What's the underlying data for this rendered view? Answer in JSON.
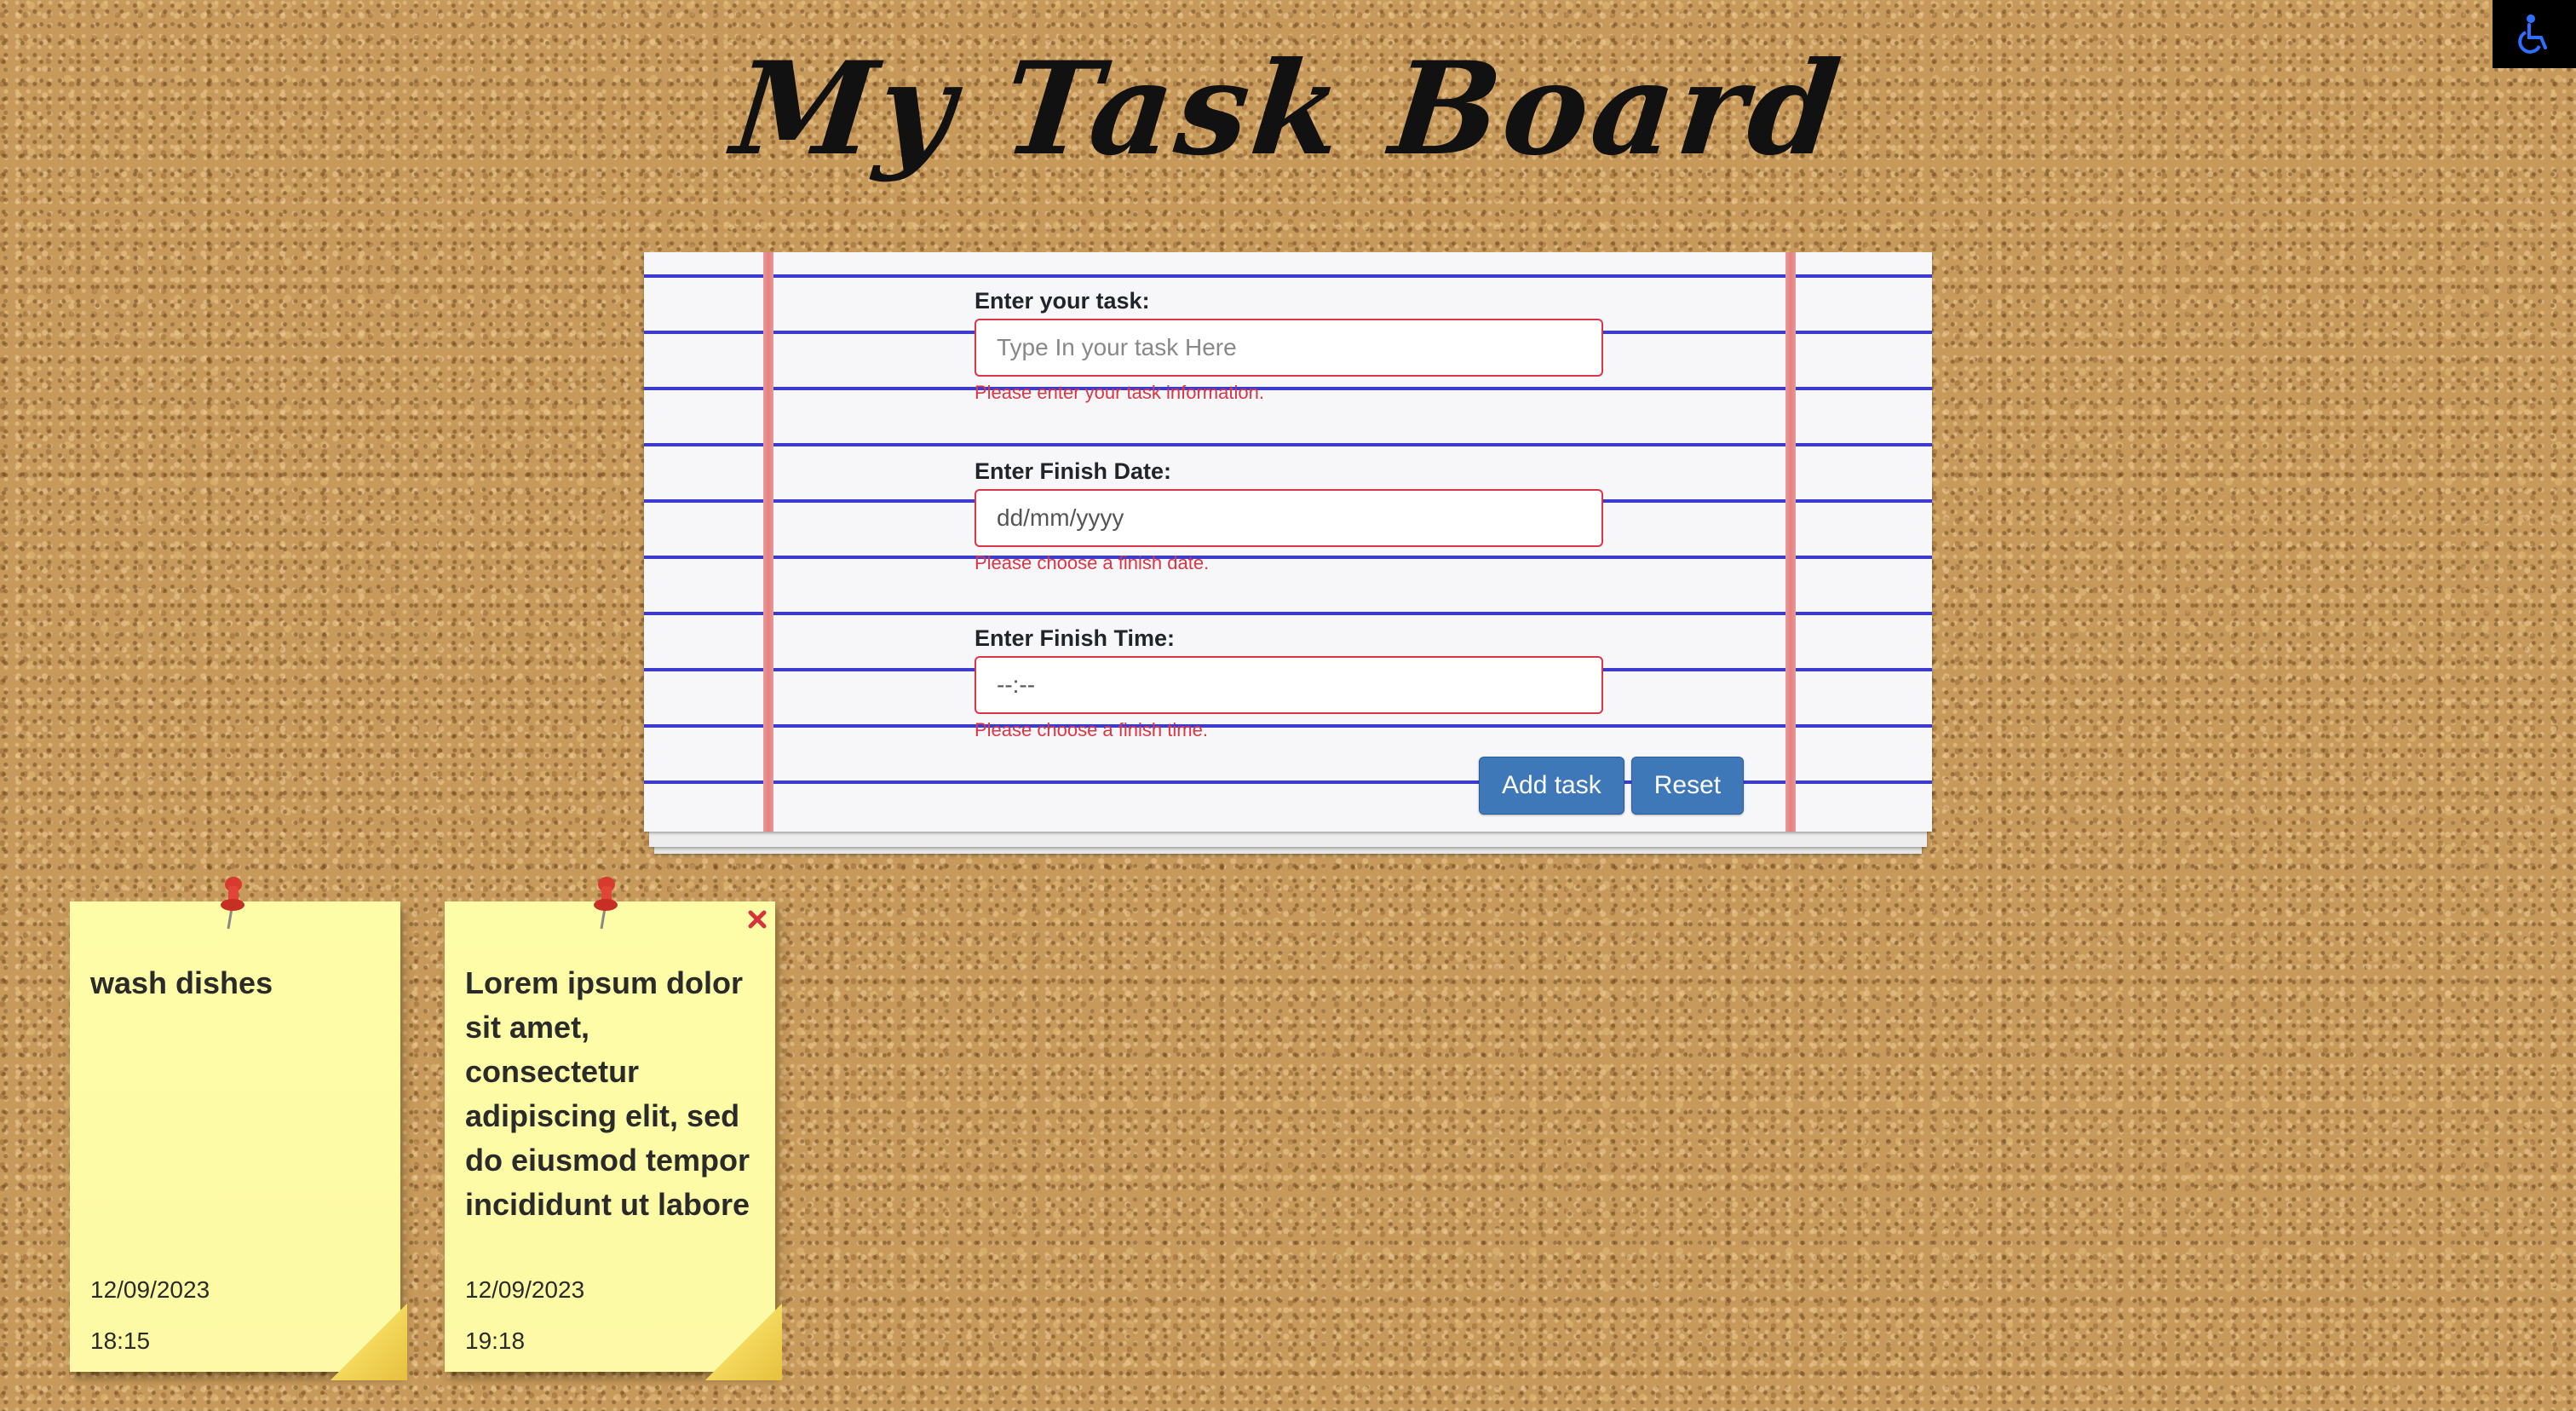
{
  "page": {
    "title": "My Task Board"
  },
  "accessibility": {
    "icon": "wheelchair-icon",
    "icon_color": "#2f6fff"
  },
  "form": {
    "task_label": "Enter your task:",
    "task_placeholder": "Type In your task Here",
    "task_error": "Please enter your task information.",
    "date_label": "Enter Finish Date:",
    "date_placeholder": "dd/mm/yyyy",
    "date_error": "Please choose a finish date.",
    "time_label": "Enter Finish Time:",
    "time_placeholder": "--:--",
    "time_error": "Please choose a finish time.",
    "add_label": "Add task",
    "reset_label": "Reset"
  },
  "notes": [
    {
      "text": "wash dishes",
      "date": "12/09/2023",
      "time": "18:15",
      "pin_icon": "pushpin-icon"
    },
    {
      "text": "Lorem ipsum dolor sit amet, consectetur adipiscing elit, sed do eiusmod tempor incididunt ut labore",
      "date": "12/09/2023",
      "time": "19:18",
      "pin_icon": "pushpin-icon",
      "close_icon": "close-icon"
    }
  ],
  "colors": {
    "error": "#dc3545",
    "button": "#3f78b9",
    "note": "#fefda7",
    "rule_line": "#3b3bcf",
    "margin_line": "#e57f7f"
  }
}
